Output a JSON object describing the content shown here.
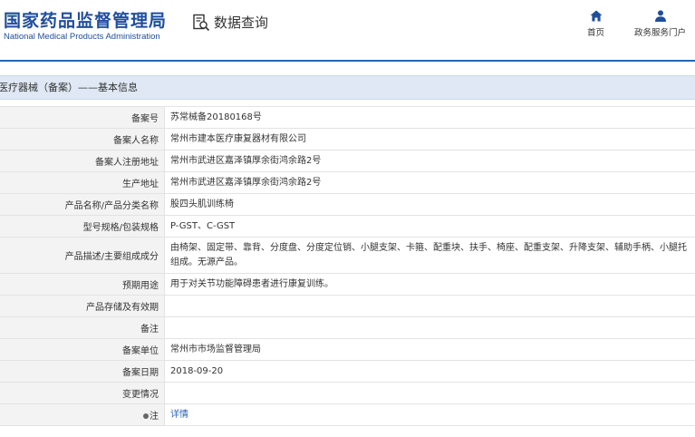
{
  "header": {
    "logo_cn": "国家药品监督管理局",
    "logo_en": "National Medical Products Administration",
    "page_title": "数据查询",
    "nav": [
      {
        "label": "首页",
        "icon": "home-icon"
      },
      {
        "label": "政务服务门户",
        "icon": "user-icon"
      }
    ],
    "brand_color": "#1f4e9c"
  },
  "section": {
    "title": "医疗器械（备案）——基本信息"
  },
  "rows": [
    {
      "label": "备案号",
      "value": "苏常械备20180168号"
    },
    {
      "label": "备案人名称",
      "value": "常州市建本医疗康复器材有限公司"
    },
    {
      "label": "备案人注册地址",
      "value": "常州市武进区嘉泽镇厚余街鸿余路2号"
    },
    {
      "label": "生产地址",
      "value": "常州市武进区嘉泽镇厚余街鸿余路2号"
    },
    {
      "label": "产品名称/产品分类名称",
      "value": "股四头肌训练椅"
    },
    {
      "label": "型号规格/包装规格",
      "value": "P-GST、C-GST"
    },
    {
      "label": "产品描述/主要组成成分",
      "value": "由椅架、固定带、靠背、分度盘、分度定位销、小腿支架、卡箍、配重块、扶手、椅座、配重支架、升降支架、辅助手柄、小腿托组成。无源产品。"
    },
    {
      "label": "预期用途",
      "value": "用于对关节功能障碍患者进行康复训练。"
    },
    {
      "label": "产品存储及有效期",
      "value": ""
    },
    {
      "label": "备注",
      "value": ""
    },
    {
      "label": "备案单位",
      "value": "常州市市场监督管理局"
    },
    {
      "label": "备案日期",
      "value": "2018-09-20"
    },
    {
      "label": "变更情况",
      "value": ""
    }
  ],
  "note_row": {
    "label": "注",
    "link": "详情"
  }
}
